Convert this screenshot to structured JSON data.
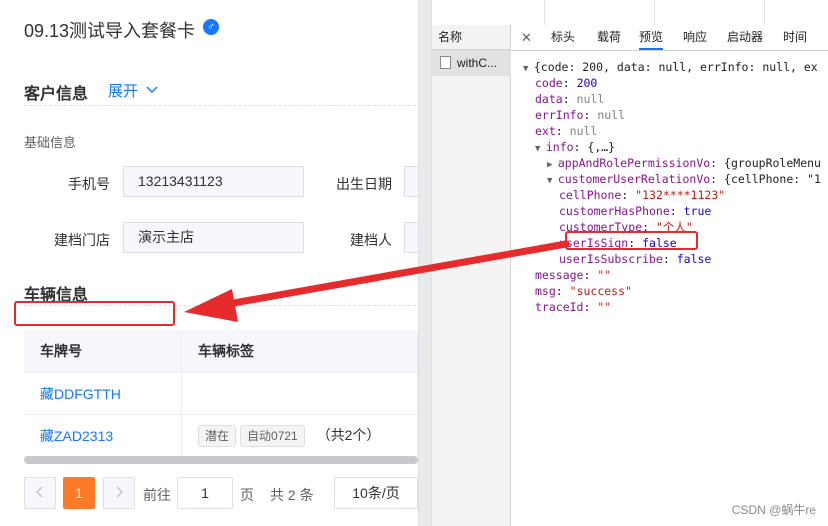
{
  "left": {
    "title": "09.13测试导入套餐卡",
    "gender_symbol": "♂",
    "customer_section": {
      "heading": "客户信息",
      "expand_label": "展开"
    },
    "basic_info": {
      "subheading": "基础信息",
      "fields": [
        {
          "label": "手机号",
          "value": "13213431123"
        },
        {
          "label": "出生日期",
          "value": ""
        },
        {
          "label": "建档门店",
          "value": "演示主店"
        },
        {
          "label": "建档人",
          "value": ""
        }
      ]
    },
    "vehicle_section": {
      "heading": "车辆信息",
      "columns": [
        "车牌号",
        "车辆标签"
      ],
      "rows": [
        {
          "plate": "藏DDFGTTH",
          "tags": [],
          "count": ""
        },
        {
          "plate": "藏ZAD2313",
          "tags": [
            "潜在",
            "自动0721"
          ],
          "count": "（共2个）"
        }
      ]
    },
    "pagination": {
      "prev_icon": "chevron-left-icon",
      "next_icon": "chevron-right-icon",
      "current_page": "1",
      "goto_label": "前往",
      "goto_value": "1",
      "page_unit": "页",
      "total": "共 2 条",
      "page_size": "10条/页"
    }
  },
  "devtools": {
    "name_column_header": "名称",
    "request_name": "withC...",
    "tabs": [
      "标头",
      "载荷",
      "预览",
      "响应",
      "启动器",
      "时间"
    ],
    "active_tab": "预览",
    "json_lines": [
      {
        "indent": 0,
        "toggle": "open",
        "text": "{code: 200, data: null, errInfo: null, ex"
      },
      {
        "indent": 1,
        "key": "code",
        "value": "200",
        "type": "num"
      },
      {
        "indent": 1,
        "key": "data",
        "value": "null",
        "type": "nul"
      },
      {
        "indent": 1,
        "key": "errInfo",
        "value": "null",
        "type": "nul"
      },
      {
        "indent": 1,
        "key": "ext",
        "value": "null",
        "type": "nul"
      },
      {
        "indent": 1,
        "toggle": "open",
        "key": "info",
        "value": "{,…}",
        "type": "pl"
      },
      {
        "indent": 2,
        "toggle": "closed",
        "key": "appAndRolePermissionVo",
        "value": "{groupRoleMenu",
        "type": "pl"
      },
      {
        "indent": 2,
        "toggle": "open",
        "key": "customerUserRelationVo",
        "value": "{cellPhone: \"1",
        "type": "pl"
      },
      {
        "indent": 3,
        "key": "cellPhone",
        "value": "\"132****1123\"",
        "type": "str"
      },
      {
        "indent": 3,
        "key": "customerHasPhone",
        "value": "true",
        "type": "num"
      },
      {
        "indent": 3,
        "key": "customerType",
        "value": "\"个人\"",
        "type": "str"
      },
      {
        "indent": 3,
        "key": "userIsSign",
        "value": "false",
        "type": "num"
      },
      {
        "indent": 3,
        "key": "userIsSubscribe",
        "value": "false",
        "type": "num"
      },
      {
        "indent": 1,
        "key": "message",
        "value": "\"\"",
        "type": "str"
      },
      {
        "indent": 1,
        "key": "msg",
        "value": "\"success\"",
        "type": "str"
      },
      {
        "indent": 1,
        "key": "traceId",
        "value": "\"\"",
        "type": "str"
      }
    ]
  },
  "watermark": "CSDN @蜗牛re",
  "colors": {
    "annotation_red": "#e52b2b",
    "accent_blue": "#1677ff",
    "page_orange": "#ff7a26"
  }
}
